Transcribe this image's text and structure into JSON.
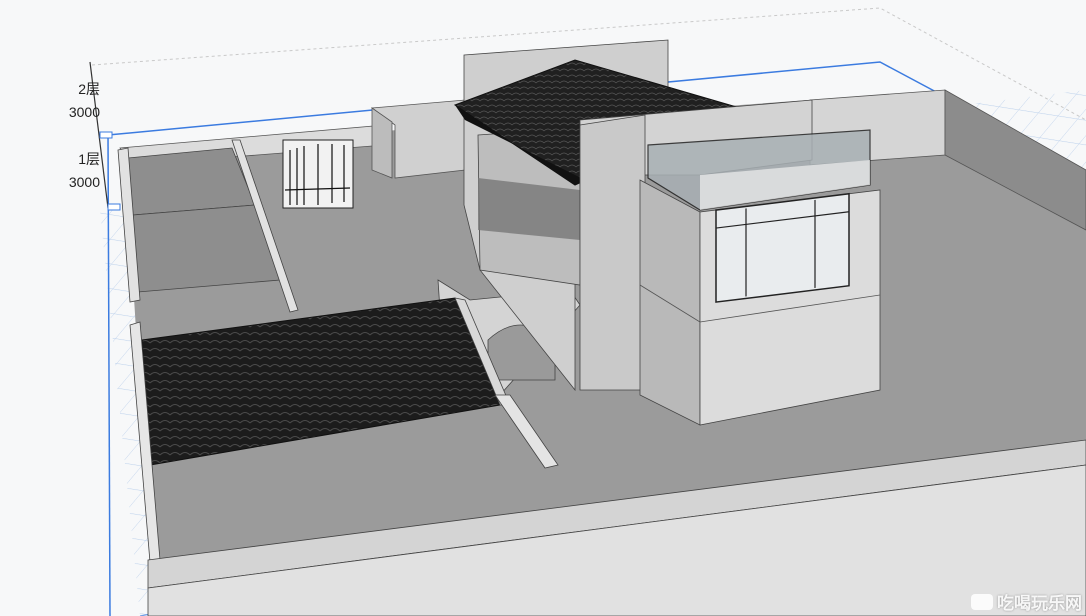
{
  "floors": [
    {
      "name": "2层",
      "height": "3000"
    },
    {
      "name": "1层",
      "height": "3000"
    }
  ],
  "watermark": {
    "text": "吃喝玩乐网",
    "icon": "watermark-logo-icon"
  },
  "colors": {
    "background": "#f7f8f9",
    "grid_line": "#9fc0ea",
    "bounding_box": "#3b7be0",
    "wall_top": "#d9d9d9",
    "wall_face": "#bdbdbd",
    "floor_slab": "#9a9a9a",
    "roof_tile": "#1d1d1d",
    "glass": "#a9b0b3"
  }
}
